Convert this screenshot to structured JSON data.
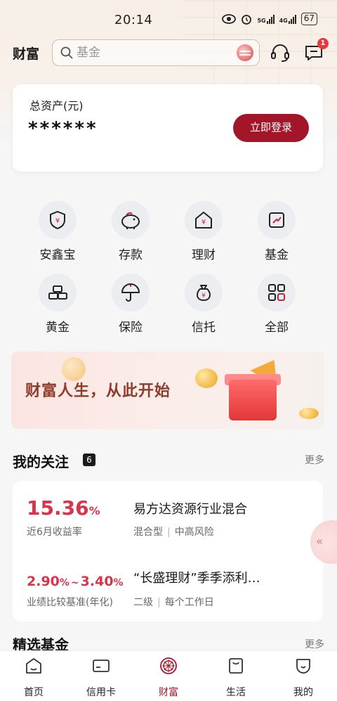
{
  "status_bar": {
    "time": "20:14",
    "battery": "67",
    "net1": "5G",
    "net2": "4G"
  },
  "header": {
    "title": "财富",
    "search_placeholder": "基金",
    "message_badge": "1"
  },
  "asset_card": {
    "label": "总资产(元)",
    "value": "******",
    "login_button": "立即登录"
  },
  "quick_menu": [
    {
      "label": "安鑫宝",
      "icon": "shield-yuan-icon"
    },
    {
      "label": "存款",
      "icon": "piggy-bank-icon"
    },
    {
      "label": "理财",
      "icon": "house-yuan-icon"
    },
    {
      "label": "基金",
      "icon": "trend-chart-icon"
    },
    {
      "label": "黄金",
      "icon": "gold-bars-icon"
    },
    {
      "label": "保险",
      "icon": "umbrella-icon"
    },
    {
      "label": "信托",
      "icon": "money-bag-icon"
    },
    {
      "label": "全部",
      "icon": "grid-all-icon"
    }
  ],
  "banner": {
    "text": "财富人生，从此开始"
  },
  "follow": {
    "title": "我的关注",
    "count": "6",
    "more": "更多",
    "items": [
      {
        "rate": "15.36",
        "rate_unit": "%",
        "rate_label": "近6月收益率",
        "name": "易方达资源行业混合",
        "tag1": "混合型",
        "tag2": "中高风险"
      },
      {
        "rate_low": "2.90",
        "rate_high": "3.40",
        "rate_unit": "%",
        "range_sep": "~",
        "rate_label": "业绩比较基准(年化)",
        "name": "“长盛理财”季季添利…",
        "tag1": "二级",
        "tag2": "每个工作日"
      }
    ]
  },
  "selected_funds": {
    "title": "精选基金",
    "more": "更多"
  },
  "side_tab": {
    "label": "«"
  },
  "tabbar": [
    {
      "label": "首页",
      "icon": "home-icon"
    },
    {
      "label": "信用卡",
      "icon": "credit-card-icon"
    },
    {
      "label": "财富",
      "icon": "wealth-icon",
      "active": true
    },
    {
      "label": "生活",
      "icon": "shopping-bag-icon"
    },
    {
      "label": "我的",
      "icon": "profile-icon"
    }
  ],
  "colors": {
    "brand": "#a3162a",
    "rate": "#d8344a",
    "banner_text": "#8e3b2a"
  }
}
